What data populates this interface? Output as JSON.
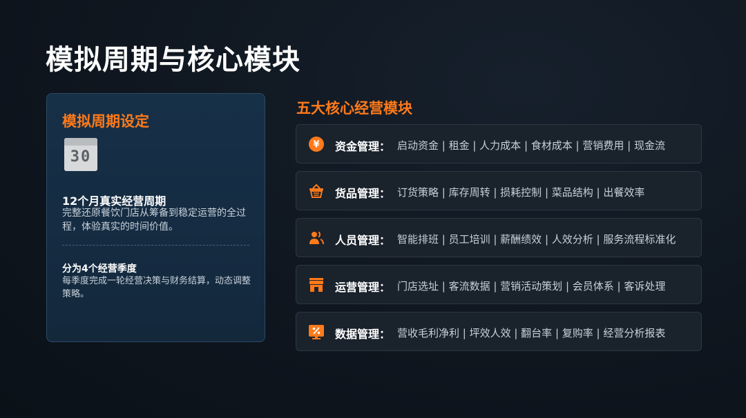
{
  "page": {
    "title": "模拟周期与核心模块"
  },
  "cycle": {
    "heading": "模拟周期设定",
    "calendar_number": "30",
    "period_title": "12个月真实经营周期",
    "period_desc": "完整还原餐饮门店从筹备到稳定运营的全过程，体验真实的时间价值。",
    "season_title": "分为4个经营季度",
    "season_desc": "每季度完成一轮经营决策与财务结算，动态调整策略。"
  },
  "modules": {
    "heading": "五大核心经营模块",
    "items": [
      {
        "name": "资金管理：",
        "items": "启动资金 | 租金 | 人力成本 | 食材成本 | 营销费用 | 现金流",
        "icon": "yen-coin-icon"
      },
      {
        "name": "货品管理：",
        "items": "订货策略 | 库存周转 | 损耗控制 | 菜品结构 | 出餐效率",
        "icon": "basket-icon"
      },
      {
        "name": "人员管理：",
        "items": "智能排班 | 员工培训 | 薪酬绩效 | 人效分析 | 服务流程标准化",
        "icon": "users-icon"
      },
      {
        "name": "运营管理：",
        "items": "门店选址 | 客流数据 | 营销活动策划 | 会员体系 | 客诉处理",
        "icon": "store-icon"
      },
      {
        "name": "数据管理：",
        "items": "营收毛利净利 | 坪效人效 | 翻台率 | 复购率 | 经营分析报表",
        "icon": "percent-board-icon"
      }
    ]
  },
  "colors": {
    "accent": "#ff7a1a",
    "background": "#0f161f",
    "card": "#14283c"
  }
}
